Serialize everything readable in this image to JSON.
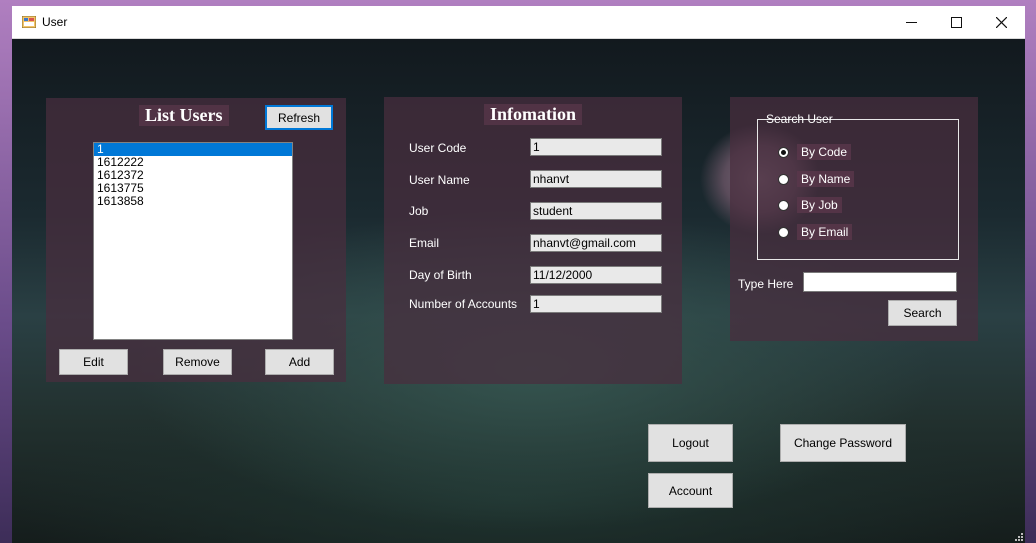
{
  "window": {
    "title": "User",
    "controls": {
      "minimize": "—",
      "maximize": "☐",
      "close": "✕"
    }
  },
  "list_panel": {
    "heading": "List Users",
    "refresh_label": "Refresh",
    "items": [
      "1",
      "1612222",
      "1612372",
      "1613775",
      "1613858"
    ],
    "selected_index": 0,
    "edit_label": "Edit",
    "remove_label": "Remove",
    "add_label": "Add"
  },
  "info_panel": {
    "heading": "Infomation",
    "fields": [
      {
        "label": "User Code",
        "value": "1"
      },
      {
        "label": "User Name",
        "value": "nhanvt"
      },
      {
        "label": "Job",
        "value": "student"
      },
      {
        "label": "Email",
        "value": "nhanvt@gmail.com"
      },
      {
        "label": "Day of Birth",
        "value": "11/12/2000"
      },
      {
        "label": "Number of Accounts",
        "value": "1"
      }
    ]
  },
  "search_panel": {
    "group_title": "Search User",
    "options": [
      {
        "label": "By Code",
        "checked": true
      },
      {
        "label": "By Name",
        "checked": false
      },
      {
        "label": "By Job",
        "checked": false
      },
      {
        "label": "By Email",
        "checked": false
      }
    ],
    "type_here_label": "Type Here",
    "search_value": "",
    "search_label": "Search"
  },
  "actions": {
    "logout_label": "Logout",
    "change_password_label": "Change Password",
    "account_label": "Account"
  }
}
